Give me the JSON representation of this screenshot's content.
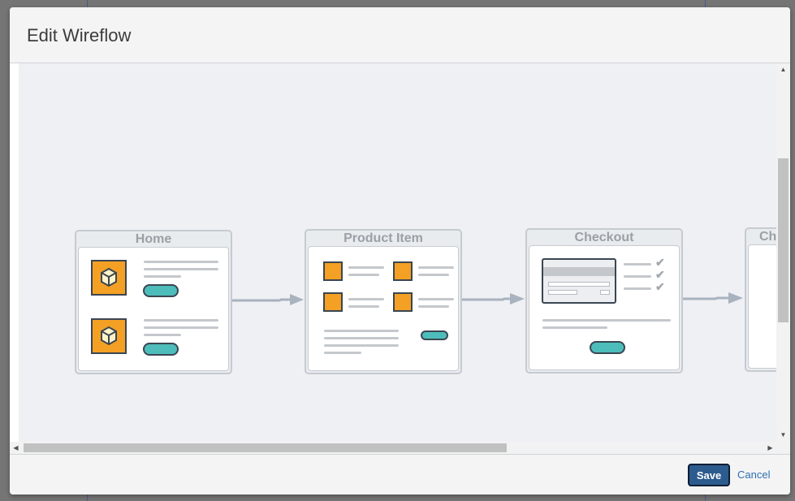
{
  "dialog": {
    "title": "Edit Wireflow"
  },
  "wireflow": {
    "screens": [
      {
        "title": "Home"
      },
      {
        "title": "Product Item"
      },
      {
        "title": "Checkout"
      },
      {
        "title": "Ch"
      }
    ]
  },
  "footer": {
    "save_label": "Save",
    "cancel_label": "Cancel"
  },
  "icons": {
    "product": "cube-icon",
    "check": "checkmark-icon",
    "scroll_up": "arrow-up-icon",
    "scroll_down": "arrow-down-icon",
    "scroll_left": "arrow-left-icon",
    "scroll_right": "arrow-right-icon"
  },
  "colors": {
    "primary_button": "#2c5b8e",
    "link": "#2d6fb5",
    "accent_orange": "#f4a024",
    "accent_teal": "#4dbdbb"
  }
}
